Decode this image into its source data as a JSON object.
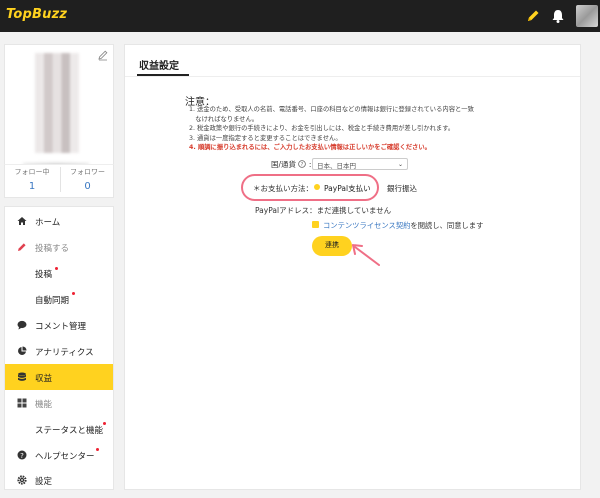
{
  "header": {
    "logo": "TopBuzz",
    "icons": [
      "pencil-icon",
      "bell-icon"
    ],
    "accent": "#ffd21f"
  },
  "profile": {
    "stats": [
      {
        "label": "フォロー中",
        "value": "1"
      },
      {
        "label": "フォロワー",
        "value": "0"
      }
    ]
  },
  "sidebar": {
    "items": [
      {
        "label": "ホーム",
        "icon": "home-icon"
      },
      {
        "label": "投稿する",
        "icon": "pencil-icon"
      },
      {
        "label": "投稿"
      },
      {
        "label": "自動同期"
      },
      {
        "label": "コメント管理",
        "icon": "comment-icon"
      },
      {
        "label": "アナリティクス",
        "icon": "pie-chart-icon"
      },
      {
        "label": "収益",
        "icon": "database-icon"
      },
      {
        "label": "機能",
        "icon": "grid-icon"
      },
      {
        "label": "ステータスと機能"
      },
      {
        "label": "ヘルプセンター",
        "icon": "help-icon"
      },
      {
        "label": "設定",
        "icon": "gear-icon"
      }
    ]
  },
  "main": {
    "title": "収益設定",
    "notice_heading": "注意：",
    "notice_lines": [
      "1. 送金のため、受取人の名前、電話番号、口座の科目などの情報は銀行に登録されている内容と一致",
      "　なければなりません。",
      "2. 税金政策や銀行の手続きにより、お金を引出しには、税金と手続き費用が差し引かれます。",
      "3. 通貨は一度指定すると変更することはできません。",
      "4. 順調に振り込まれるには、ご入力したお支払い情報は正しいかをご確認ください。"
    ],
    "country_label": "国/通貨",
    "country_value": "日本、日本円",
    "payment_label": "＊お支払い方法：",
    "payment_paypal": "PayPal支払い",
    "payment_bank": "銀行振込",
    "paypal_address": "PayPalアドレス：まだ連携していません",
    "consent_link": "コンテンツライセンス契約",
    "consent_rest": "を閲読し、同意します",
    "connect_button": "連携"
  }
}
